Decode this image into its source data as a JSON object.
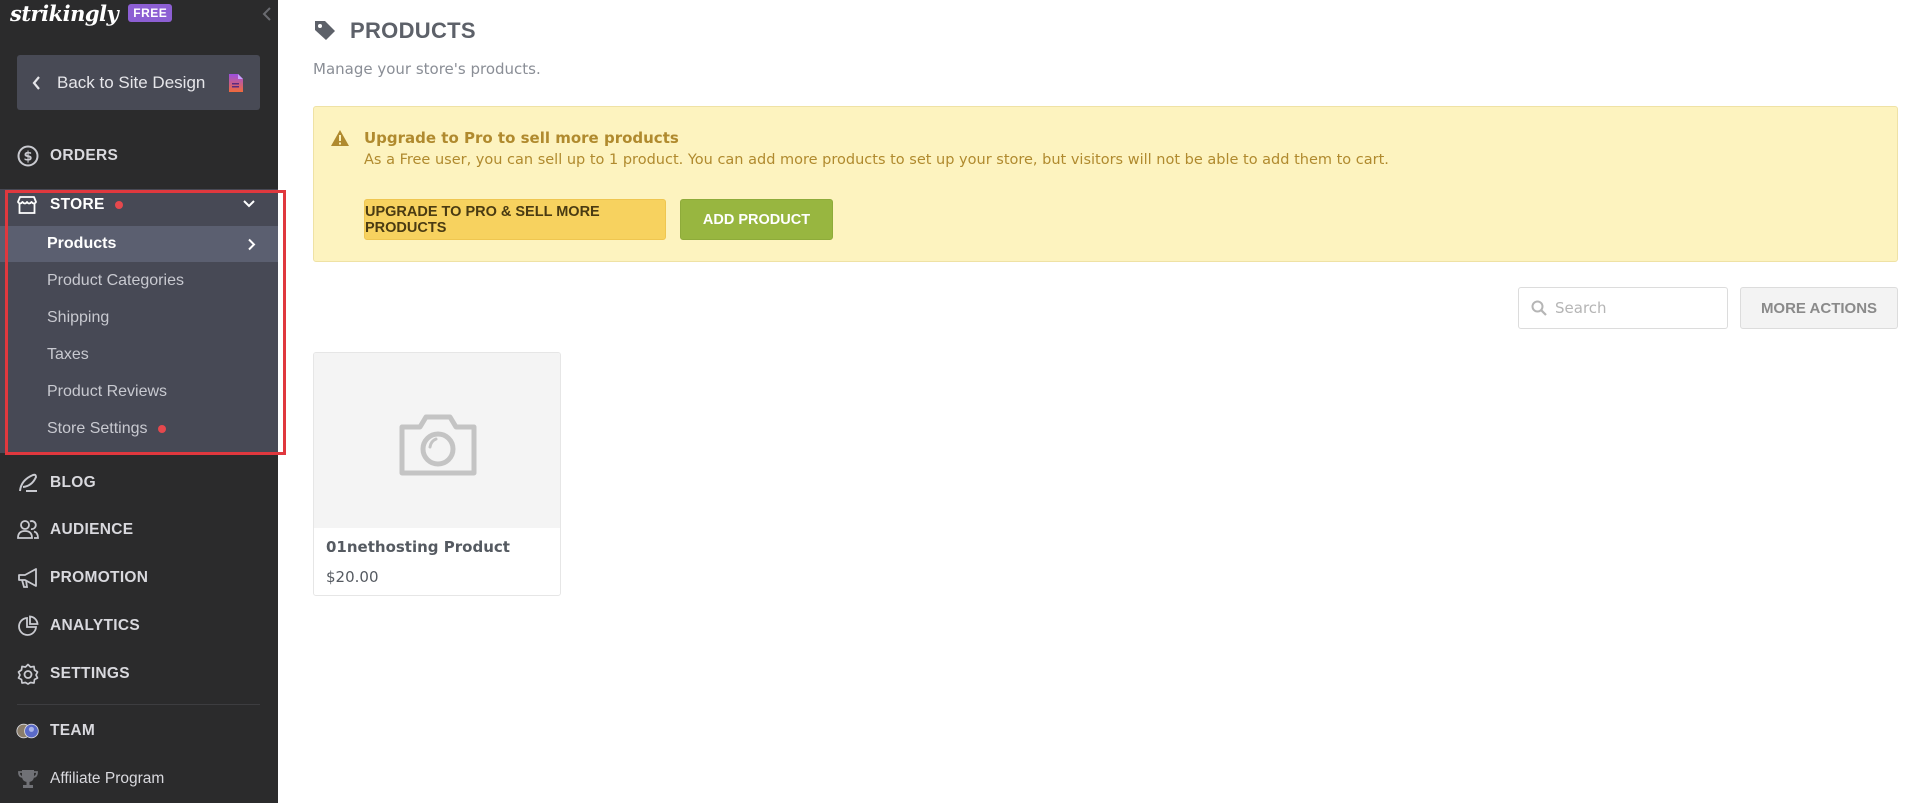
{
  "sidebar": {
    "brand": {
      "logo": "strikingly",
      "badge": "FREE"
    },
    "back_button": "Back to Site Design",
    "items": {
      "orders": "ORDERS",
      "store": "STORE",
      "blog": "BLOG",
      "audience": "AUDIENCE",
      "promotion": "PROMOTION",
      "analytics": "ANALYTICS",
      "settings": "SETTINGS",
      "team": "TEAM",
      "affiliate": "Affiliate Program"
    },
    "store_subitems": [
      {
        "label": "Products",
        "active": true
      },
      {
        "label": "Product Categories"
      },
      {
        "label": "Shipping"
      },
      {
        "label": "Taxes"
      },
      {
        "label": "Product Reviews"
      },
      {
        "label": "Store Settings",
        "dot": true
      }
    ]
  },
  "header": {
    "title": "PRODUCTS",
    "subtitle": "Manage your store's products."
  },
  "alert": {
    "title": "Upgrade to Pro to sell more products",
    "body": "As a Free user, you can sell up to 1 product. You can add more products to set up your store, but visitors will not be able to add them to cart.",
    "upgrade_button": "UPGRADE TO PRO & SELL MORE PRODUCTS",
    "add_button": "ADD PRODUCT"
  },
  "toolbar": {
    "search_placeholder": "Search",
    "search_value": "",
    "more_actions": "MORE ACTIONS"
  },
  "products": [
    {
      "name": "01nethosting Product",
      "price": "$20.00"
    }
  ],
  "colors": {
    "sidebar_bg": "#2b2b2c",
    "store_section_bg": "#474955",
    "active_item_bg": "#5b5f70",
    "highlight_red": "#e0383e",
    "badge_purple": "#8d5fd3",
    "alert_bg": "#fdf3bf",
    "alert_text": "#b08a2e",
    "upgrade_yellow": "#f7d25f",
    "add_green": "#98b640"
  }
}
